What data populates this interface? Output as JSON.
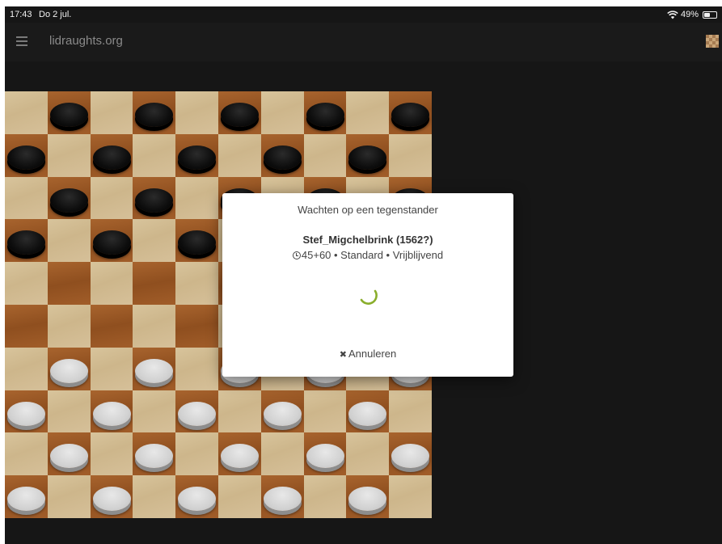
{
  "status_bar": {
    "time": "17:43",
    "date": "Do 2 jul.",
    "battery": "49%"
  },
  "header": {
    "title": "lidraughts.org",
    "menu_icon": "hamburger-icon",
    "board_icon": "board-icon"
  },
  "board": {
    "size": 10,
    "rows": [
      ".b.b.b.b.b",
      "b.b.b.b.b.",
      ".b.b.b.b.b",
      "b.b.b.b.b.",
      "..........",
      "..........",
      ".w.w.w.w.w",
      "w.w.w.w.w.",
      ".w.w.w.w.w",
      "w.w.w.w.w."
    ]
  },
  "dialog": {
    "title": "Wachten op een tegenstander",
    "opponent": "Stef_Migchelbrink (1562?)",
    "game_info": "45+60 • Standard • Vrijblijvend",
    "cancel_label": "Annuleren",
    "spinner_color": "#8aae2c"
  },
  "colors": {
    "background": "#161616",
    "header": "#1a1a1a",
    "accent": "#8aae2c"
  }
}
